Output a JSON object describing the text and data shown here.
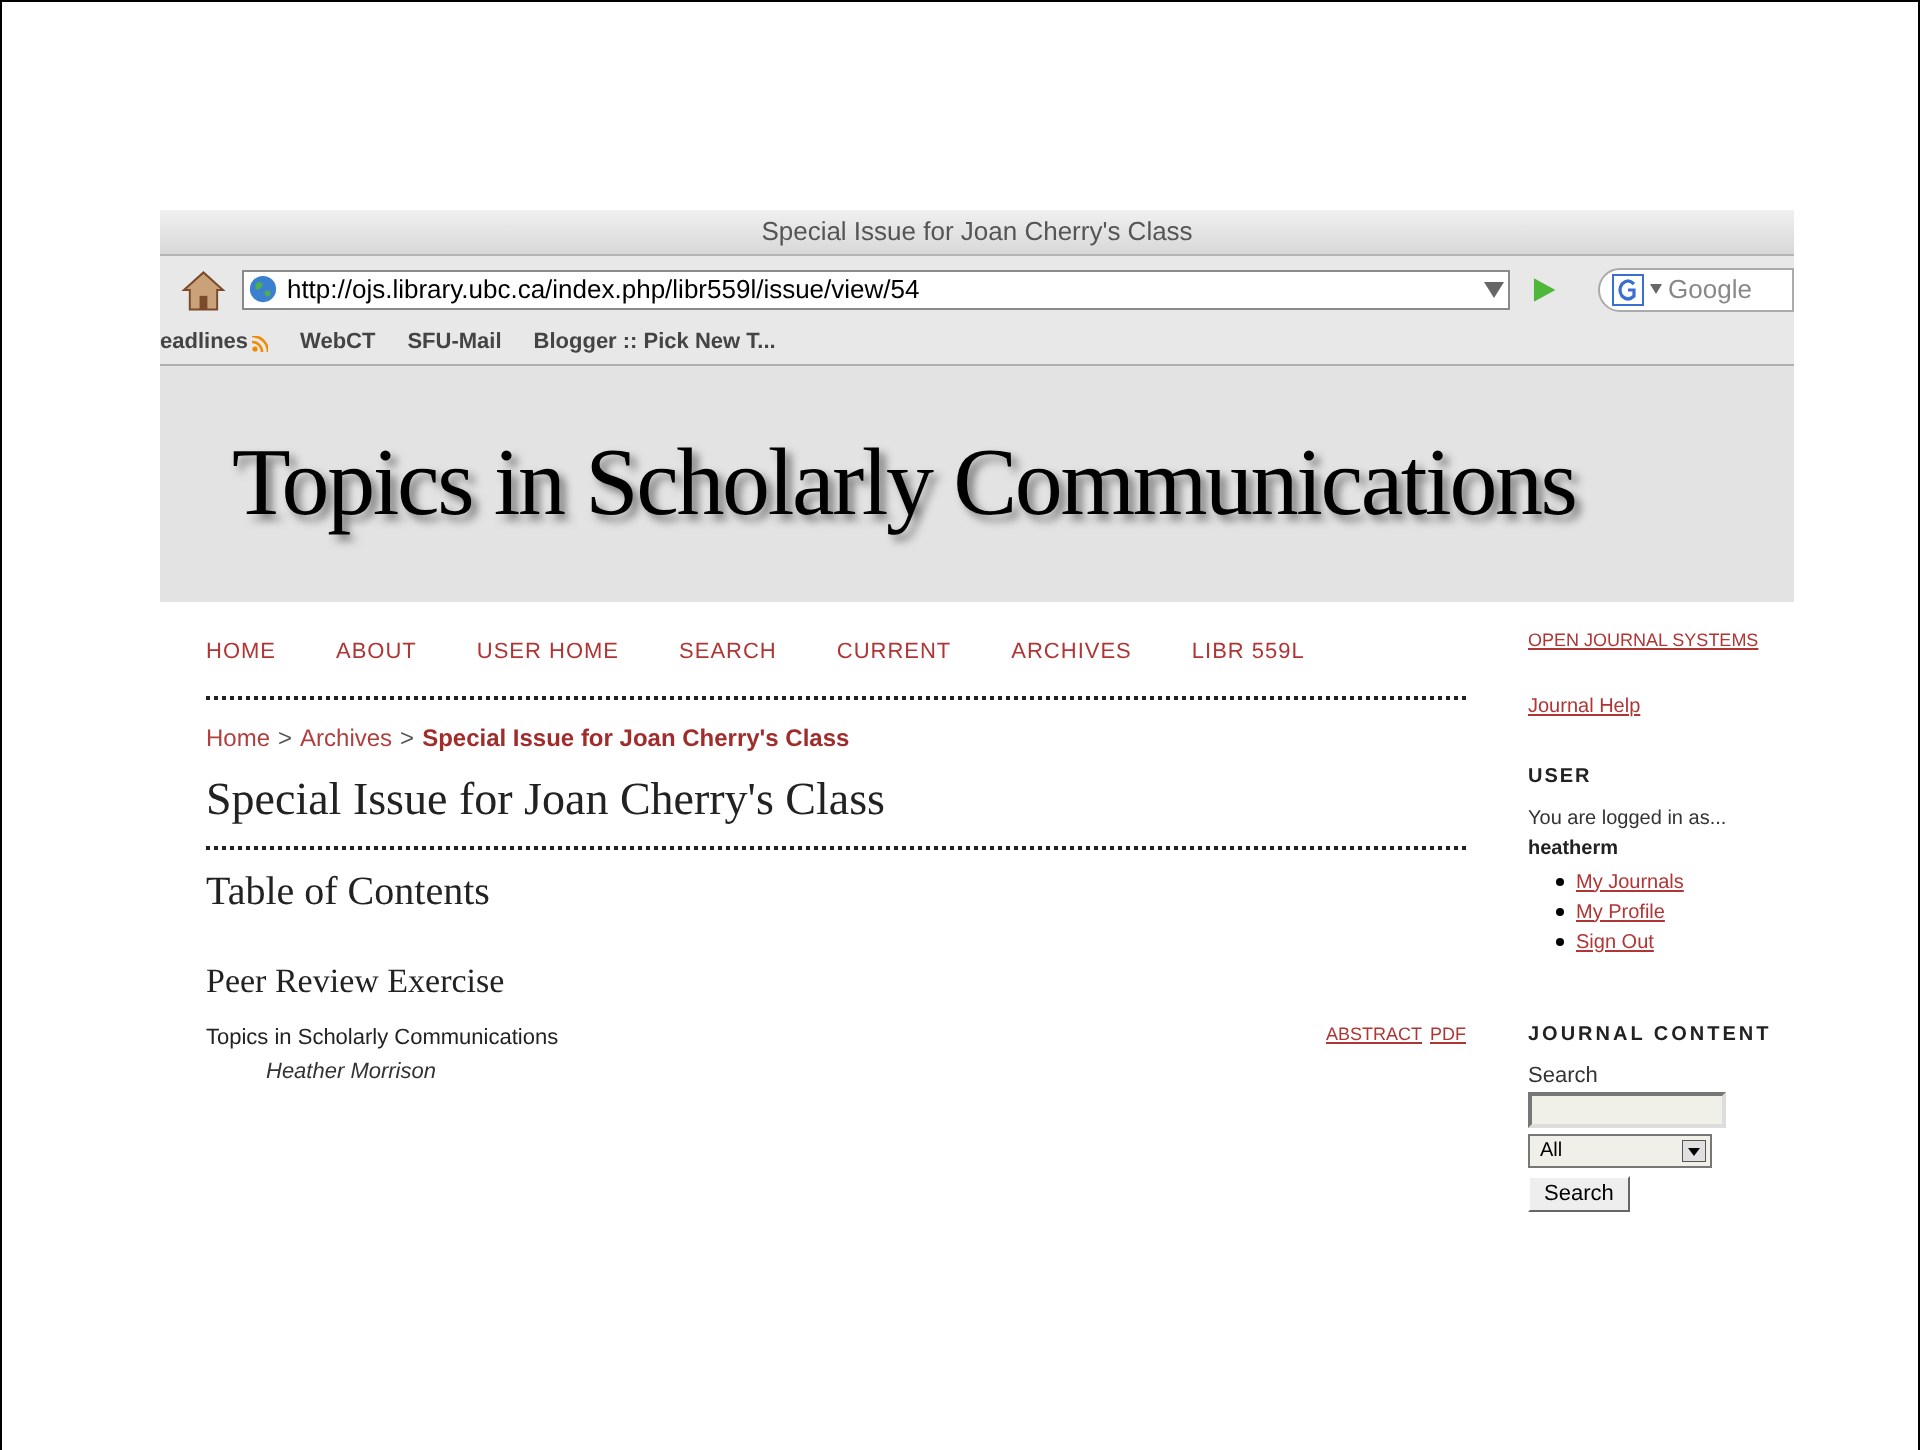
{
  "browser": {
    "title": "Special Issue for Joan Cherry's Class",
    "url": "http://ojs.library.ubc.ca/index.php/libr559l/issue/view/54",
    "search_placeholder": "Google",
    "bookmarks": [
      {
        "label": "eadlines",
        "kind": "feed"
      },
      {
        "label": "WebCT",
        "kind": "plain"
      },
      {
        "label": "SFU-Mail",
        "kind": "plain"
      },
      {
        "label": "Blogger :: Pick New T...",
        "kind": "plain"
      }
    ]
  },
  "banner": {
    "title": "Topics in Scholarly Communications"
  },
  "nav": [
    "HOME",
    "ABOUT",
    "USER HOME",
    "SEARCH",
    "CURRENT",
    "ARCHIVES",
    "LIBR 559L"
  ],
  "breadcrumb": [
    {
      "label": "Home",
      "current": false
    },
    {
      "label": "Archives",
      "current": false
    },
    {
      "label": "Special Issue for Joan Cherry's Class",
      "current": true
    }
  ],
  "breadcrumb_separator": ">",
  "page_title": "Special Issue for Joan Cherry's Class",
  "toc_heading": "Table of Contents",
  "section_heading": "Peer Review Exercise",
  "articles": [
    {
      "title": "Topics in Scholarly Communications",
      "author": "Heather Morrison",
      "links": [
        "ABSTRACT",
        "PDF"
      ]
    }
  ],
  "sidebar": {
    "ojs_link": "OPEN JOURNAL SYSTEMS",
    "help_link": "Journal Help",
    "user_heading": "USER",
    "logged_in_text": "You are logged in as...",
    "username": "heatherm",
    "user_links": [
      "My Journals",
      "My Profile",
      "Sign Out"
    ],
    "content_heading": "JOURNAL CONTENT",
    "search_label": "Search",
    "scope_value": "All",
    "search_button": "Search"
  }
}
